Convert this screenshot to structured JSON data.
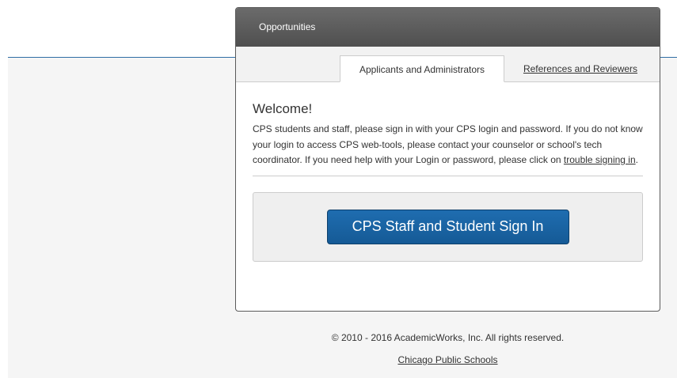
{
  "panel": {
    "title": "Opportunities",
    "tabs": [
      {
        "label": "Applicants and Administrators",
        "active": true
      },
      {
        "label": "References and Reviewers",
        "active": false
      }
    ],
    "welcome_heading": "Welcome!",
    "intro_text_before_link": "CPS students and staff, please sign in with your CPS login and password. If you do not know your login to access CPS web-tools, please contact your counselor or school's tech coordinator. If you need help with your Login or password, please click on ",
    "intro_link": "trouble signing in",
    "intro_text_after_link": ".",
    "signin_button": "CPS Staff and Student Sign In"
  },
  "footer": {
    "copyright": "© 2010 - 2016 AcademicWorks, Inc. All rights reserved.",
    "link": "Chicago Public Schools"
  },
  "colors": {
    "header_bg": "#5e5e5e",
    "accent_line": "#2f6ea5",
    "button_bg": "#1a64a3",
    "page_bg": "#f5f5f5"
  }
}
